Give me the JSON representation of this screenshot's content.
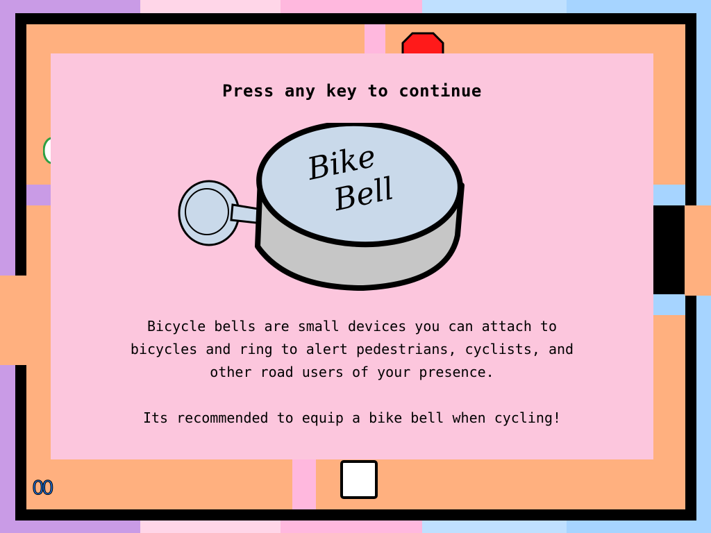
{
  "game": {
    "counter": "00",
    "dialog": {
      "prompt": "Press any key to continue",
      "item_label_line1": "Bike",
      "item_label_line2": "Bell",
      "description_lines": [
        "Bicycle bells are small devices you can attach to",
        "bicycles and ring to alert pedestrians, cyclists, and",
        "other road users of your presence."
      ],
      "tip": "Its recommended to equip a bike bell when cycling!"
    }
  },
  "colors": {
    "stripe_purple": "#c99be6",
    "stripe_pink_light": "#ffd6e8",
    "stripe_pink": "#ffb8de",
    "stripe_blue_light": "#bfe0ff",
    "stripe_blue": "#a6d4ff",
    "floor": "#ffb07f",
    "dialog_bg": "#fcc6dd",
    "bell_face": "#c9d9ea",
    "bell_side": "#c6c6c6",
    "stop_red": "#ff1a1a",
    "counter_blue": "#1f6fd6"
  },
  "icons": {
    "item": "bike-bell-illustration",
    "top_hazard": "stop-sign-icon",
    "player": "player-square",
    "left_marker": "green-ring-icon"
  }
}
